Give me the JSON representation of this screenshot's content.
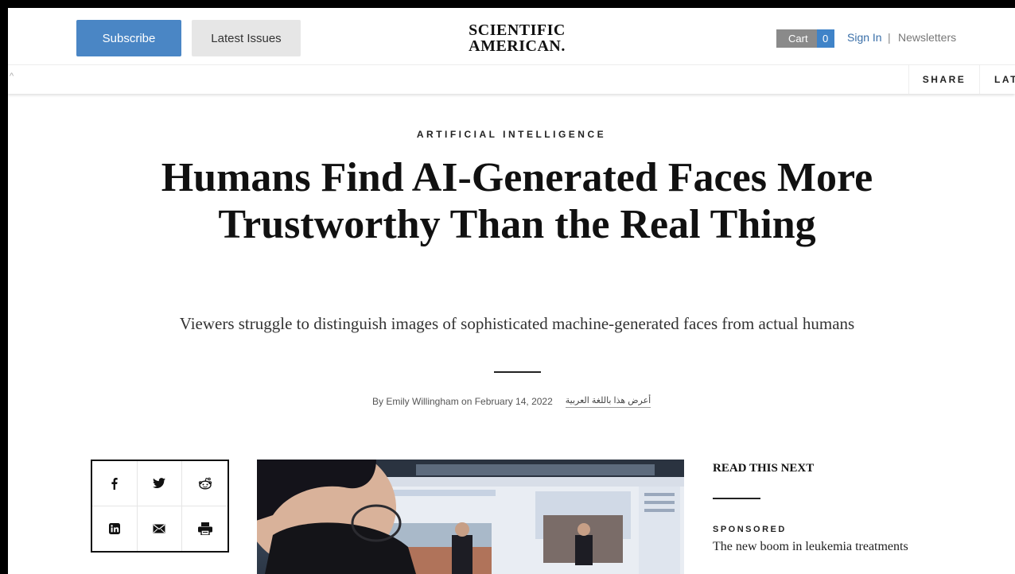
{
  "header": {
    "subscribe_label": "Subscribe",
    "latest_issues_label": "Latest Issues",
    "logo_line1": "SCIENTIFIC",
    "logo_line2": "AMERICAN.",
    "cart_label": "Cart",
    "cart_count": "0",
    "sign_in_label": "Sign In",
    "separator": "|",
    "newsletters_label": "Newsletters"
  },
  "toolbar": {
    "share_label": "SHARE",
    "latest_label": "LAT"
  },
  "article": {
    "kicker": "ARTIFICIAL INTELLIGENCE",
    "title": "Humans Find AI-Generated Faces More Trustworthy Than the Real Thing",
    "dek": "Viewers struggle to distinguish images of sophisticated machine-generated faces from actual humans",
    "byline": "By Emily Willingham on February 14, 2022",
    "arabic_link": "أعرض هذا باللغة العربية"
  },
  "share_icons": [
    "facebook-icon",
    "twitter-icon",
    "reddit-icon",
    "linkedin-icon",
    "email-icon",
    "print-icon"
  ],
  "sidebar": {
    "heading": "READ THIS NEXT",
    "sponsored_label": "SPONSORED",
    "link_text": "The new boom in leukemia treatments"
  },
  "colors": {
    "subscribe_bg": "#4a86c5",
    "cart_count_bg": "#3f83c8",
    "link_blue": "#3a6fa8"
  }
}
